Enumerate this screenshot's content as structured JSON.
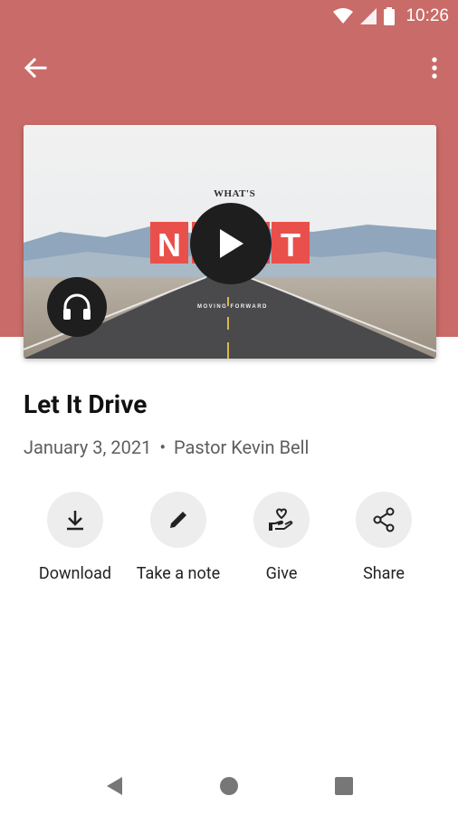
{
  "status_bar": {
    "time": "10:26",
    "icons": [
      "wifi-icon",
      "cell-signal-icon",
      "battery-icon"
    ]
  },
  "appbar": {
    "back_icon": "arrow-left-icon",
    "more_icon": "more-vertical-icon"
  },
  "media": {
    "artwork_small_text": "WHAT'S",
    "artwork_big_text": "NEXT",
    "artwork_tagline": "MOVING FORWARD",
    "play_icon": "play-icon",
    "audio_icon": "headphones-icon"
  },
  "sermon": {
    "title": "Let It Drive",
    "date": "January 3, 2021",
    "separator": "•",
    "speaker": "Pastor Kevin Bell"
  },
  "actions": [
    {
      "label": "Download",
      "icon": "download-icon"
    },
    {
      "label": "Take a note",
      "icon": "pencil-icon"
    },
    {
      "label": "Give",
      "icon": "give-hand-heart-icon"
    },
    {
      "label": "Share",
      "icon": "share-icon"
    }
  ],
  "nav": {
    "back_icon": "nav-back-triangle-icon",
    "home_icon": "nav-home-circle-icon",
    "recents_icon": "nav-recents-square-icon"
  },
  "colors": {
    "header": "#c96b68",
    "action_bg": "#ededed",
    "accent_red": "#e9504b"
  }
}
